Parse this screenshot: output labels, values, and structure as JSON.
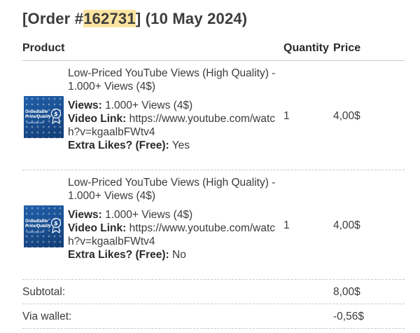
{
  "order": {
    "prefix": "[Order #",
    "number": "162731",
    "suffix": "] (10 May 2024)"
  },
  "columns": {
    "product": "Product",
    "quantity": "Quantity",
    "price": "Price"
  },
  "items": [
    {
      "name": "Low-Priced YouTube Views (High Quality) - 1.000+ Views (4$)",
      "thumb_title": "Unbeatable Price/Quality",
      "thumb_sub": "socialsurge.com",
      "views_label": "Views:",
      "views_value": " 1.000+ Views (4$)",
      "link_label": "Video Link:",
      "link_value": " https://www.youtube.com/watch?v=kgaalbFWtv4",
      "likes_label": "Extra Likes? (Free):",
      "likes_value": " Yes",
      "quantity": "1",
      "price": "4,00$"
    },
    {
      "name": "Low-Priced YouTube Views (High Quality) - 1.000+ Views (4$)",
      "thumb_title": "Unbeatable Price/Quality",
      "thumb_sub": "socialsurge.com",
      "views_label": "Views:",
      "views_value": " 1.000+ Views (4$)",
      "link_label": "Video Link:",
      "link_value": " https://www.youtube.com/watch?v=kgaalbFWtv4",
      "likes_label": "Extra Likes? (Free):",
      "likes_value": " No",
      "quantity": "1",
      "price": "4,00$"
    }
  ],
  "totals": {
    "subtotal_label": "Subtotal:",
    "subtotal_value": "8,00$",
    "wallet_label": "Via wallet:",
    "wallet_value": "-0,56$"
  },
  "colors": {
    "highlight": "#fbe3a0",
    "thumb_blue": "#1f5fa8"
  }
}
